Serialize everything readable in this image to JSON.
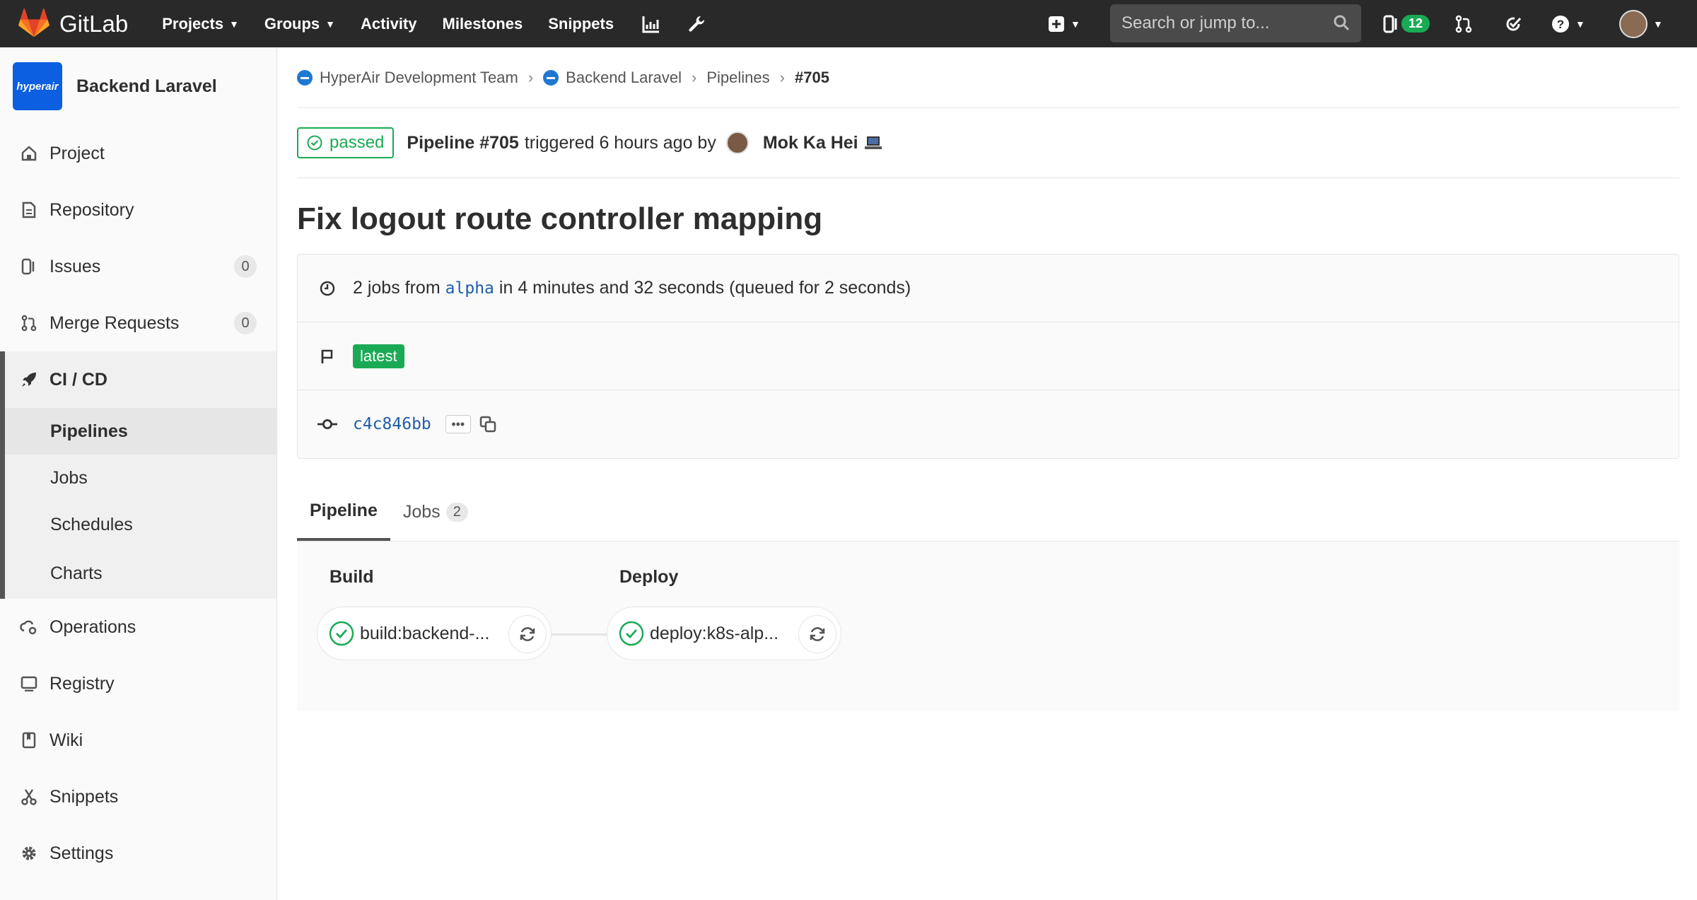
{
  "navbar": {
    "brand": "GitLab",
    "links": [
      {
        "label": "Projects",
        "dropdown": true
      },
      {
        "label": "Groups",
        "dropdown": true
      },
      {
        "label": "Activity",
        "dropdown": false
      },
      {
        "label": "Milestones",
        "dropdown": false
      },
      {
        "label": "Snippets",
        "dropdown": false
      }
    ],
    "search_placeholder": "Search or jump to...",
    "issues_count": "12"
  },
  "sidebar": {
    "project_avatar_text": "hyperair",
    "project_name": "Backend Laravel",
    "items": [
      {
        "label": "Project",
        "icon": "home-icon"
      },
      {
        "label": "Repository",
        "icon": "doc-icon"
      },
      {
        "label": "Issues",
        "icon": "issues-icon",
        "count": "0"
      },
      {
        "label": "Merge Requests",
        "icon": "merge-icon",
        "count": "0"
      },
      {
        "label": "CI / CD",
        "icon": "rocket-icon"
      },
      {
        "label": "Operations",
        "icon": "cloud-gear-icon"
      },
      {
        "label": "Registry",
        "icon": "container-icon"
      },
      {
        "label": "Wiki",
        "icon": "book-icon"
      },
      {
        "label": "Snippets",
        "icon": "scissors-icon"
      },
      {
        "label": "Settings",
        "icon": "gear-icon"
      }
    ],
    "cicd_sub": [
      "Pipelines",
      "Jobs",
      "Schedules",
      "Charts"
    ]
  },
  "breadcrumb": {
    "group": "HyperAir Development Team",
    "project": "Backend Laravel",
    "section": "Pipelines",
    "current": "#705"
  },
  "pipeline": {
    "status": "passed",
    "id_label": "Pipeline #705",
    "triggered_text": "triggered 6 hours ago by",
    "user": "Mok Ka Hei",
    "title": "Fix logout route controller mapping",
    "jobs_text_pre": "2 jobs from",
    "branch": "alpha",
    "jobs_text_post": "in 4 minutes and 32 seconds (queued for 2 seconds)",
    "tag": "latest",
    "commit": "c4c846bb"
  },
  "tabs": [
    {
      "label": "Pipeline",
      "active": true
    },
    {
      "label": "Jobs",
      "count": "2",
      "active": false
    }
  ],
  "stages": [
    {
      "name": "Build",
      "job": "build:backend-..."
    },
    {
      "name": "Deploy",
      "job": "deploy:k8s-alp..."
    }
  ]
}
